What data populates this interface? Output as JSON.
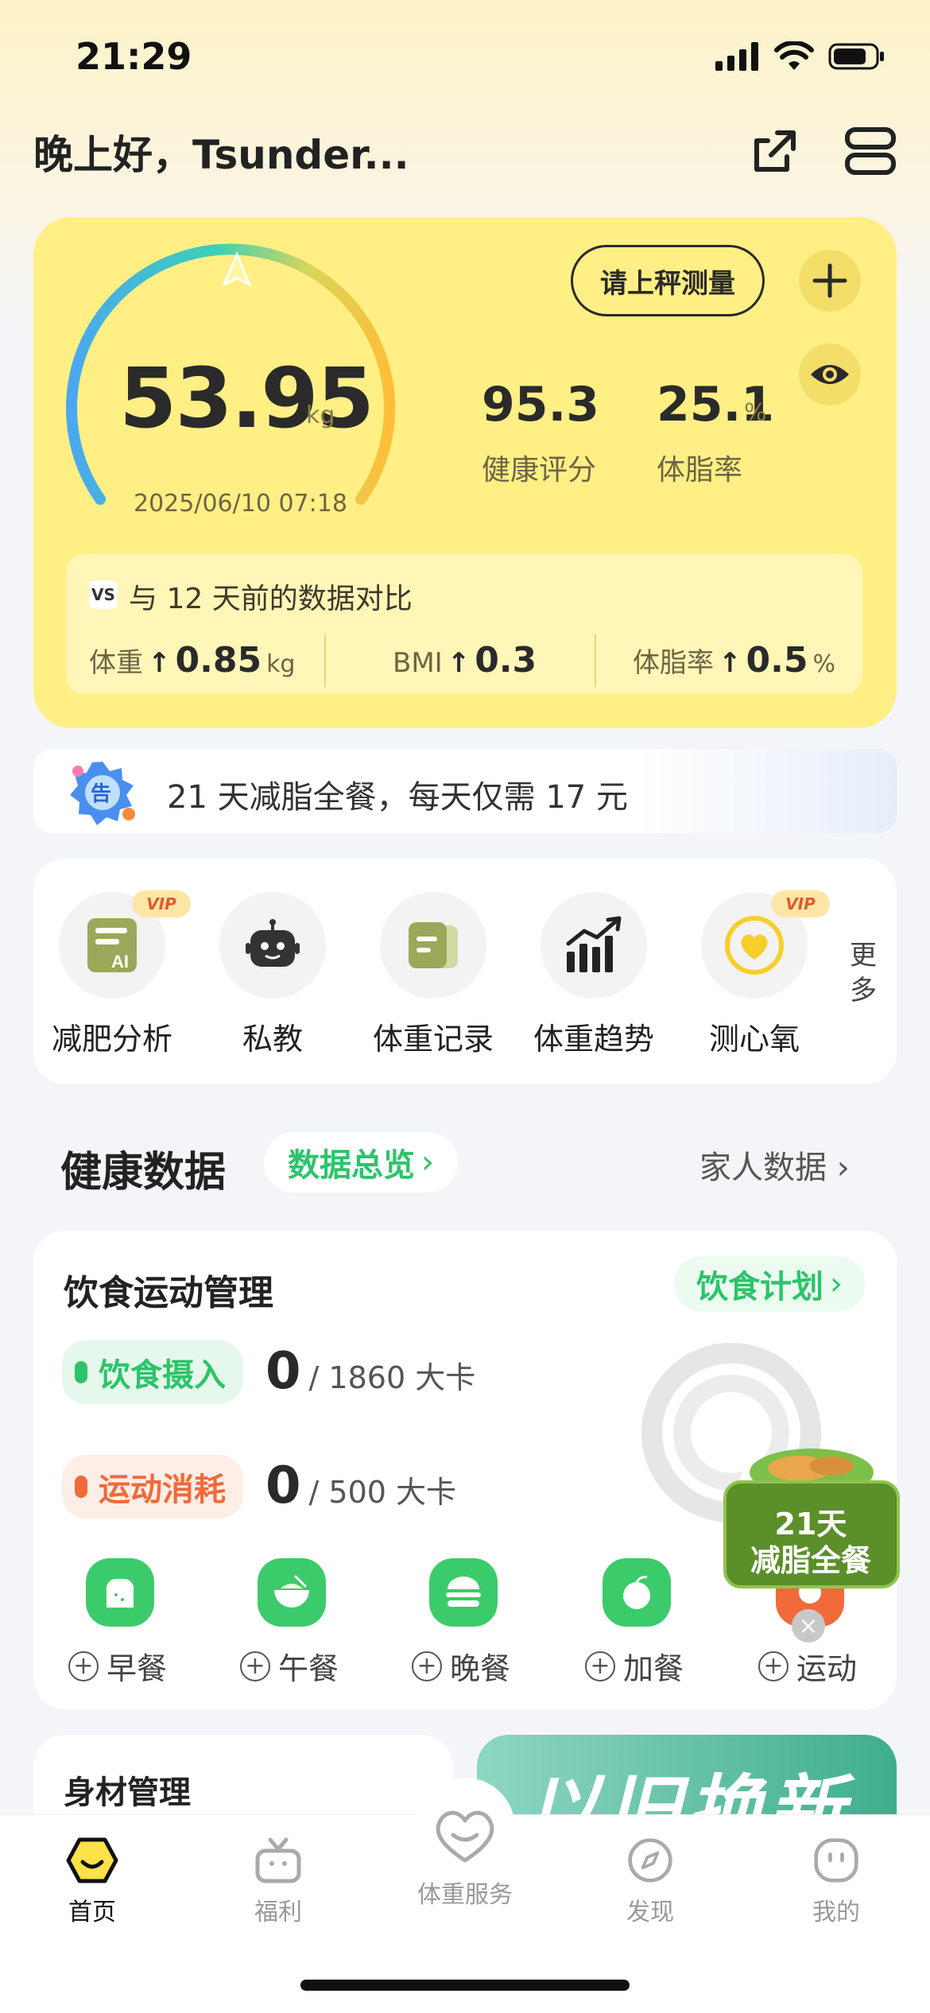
{
  "status_bar": {
    "time": "21:29"
  },
  "header": {
    "greeting": "晚上好，Tsunder...",
    "share_icon": "share-icon",
    "menu_icon": "menu-icon"
  },
  "weight_card": {
    "weight": "53.95",
    "unit": "kg",
    "datetime": "2025/06/10 07:18",
    "measure_button": "请上秤测量",
    "health_score": "95.3",
    "health_score_label": "健康评分",
    "body_fat": "25.1",
    "body_fat_unit": "%",
    "body_fat_label": "体脂率",
    "compare": {
      "badge": "VS",
      "title": "与 12 天前的数据对比",
      "items": [
        {
          "label": "体重",
          "arrow": "↑",
          "value": "0.85",
          "unit": "kg"
        },
        {
          "label": "BMI",
          "arrow": "↑",
          "value": "0.3",
          "unit": ""
        },
        {
          "label": "体脂率",
          "arrow": "↑",
          "value": "0.5",
          "unit": "%"
        }
      ]
    }
  },
  "promo": {
    "badge": "告",
    "text": "21 天减脂全餐，每天仅需 17 元"
  },
  "shortcuts": {
    "vip_badge": "VIP",
    "items": [
      {
        "label": "减肥分析",
        "icon": "ai-report-icon",
        "vip": true
      },
      {
        "label": "私教",
        "icon": "robot-icon",
        "vip": false
      },
      {
        "label": "体重记录",
        "icon": "record-icon",
        "vip": false
      },
      {
        "label": "体重趋势",
        "icon": "trend-chart-icon",
        "vip": false
      },
      {
        "label": "测心氧",
        "icon": "heart-oxygen-icon",
        "vip": true
      }
    ],
    "more": "更多"
  },
  "health": {
    "title": "健康数据",
    "overview_link": "数据总览",
    "family_link": "家人数据"
  },
  "diet": {
    "title": "饮食运动管理",
    "plan_link": "饮食计划",
    "intake": {
      "label": "饮食摄入",
      "value": "0",
      "goal": "/ 1860 大卡"
    },
    "burn": {
      "label": "运动消耗",
      "value": "0",
      "goal": "/ 500 大卡"
    },
    "meals": [
      {
        "label": "早餐",
        "icon": "toast-icon"
      },
      {
        "label": "午餐",
        "icon": "rice-bowl-icon"
      },
      {
        "label": "晚餐",
        "icon": "burger-icon"
      },
      {
        "label": "加餐",
        "icon": "fruit-icon"
      },
      {
        "label": "运动",
        "icon": "exercise-icon"
      }
    ],
    "float_ad": {
      "line1": "21天",
      "line2": "减脂全餐"
    }
  },
  "body_mgmt": {
    "title": "身材管理"
  },
  "trade_in": {
    "text": "以旧换新"
  },
  "colors": {
    "accent_green": "#2cc46b",
    "accent_orange": "#f06a3a",
    "card_yellow": "#ffef85"
  },
  "tabbar": {
    "tabs": [
      {
        "label": "首页",
        "icon": "home-face-icon",
        "active": true
      },
      {
        "label": "福利",
        "icon": "gift-icon",
        "active": false
      },
      {
        "label": "体重服务",
        "icon": "heart-service-icon",
        "active": false
      },
      {
        "label": "发现",
        "icon": "compass-icon",
        "active": false
      },
      {
        "label": "我的",
        "icon": "profile-icon",
        "active": false
      }
    ]
  }
}
